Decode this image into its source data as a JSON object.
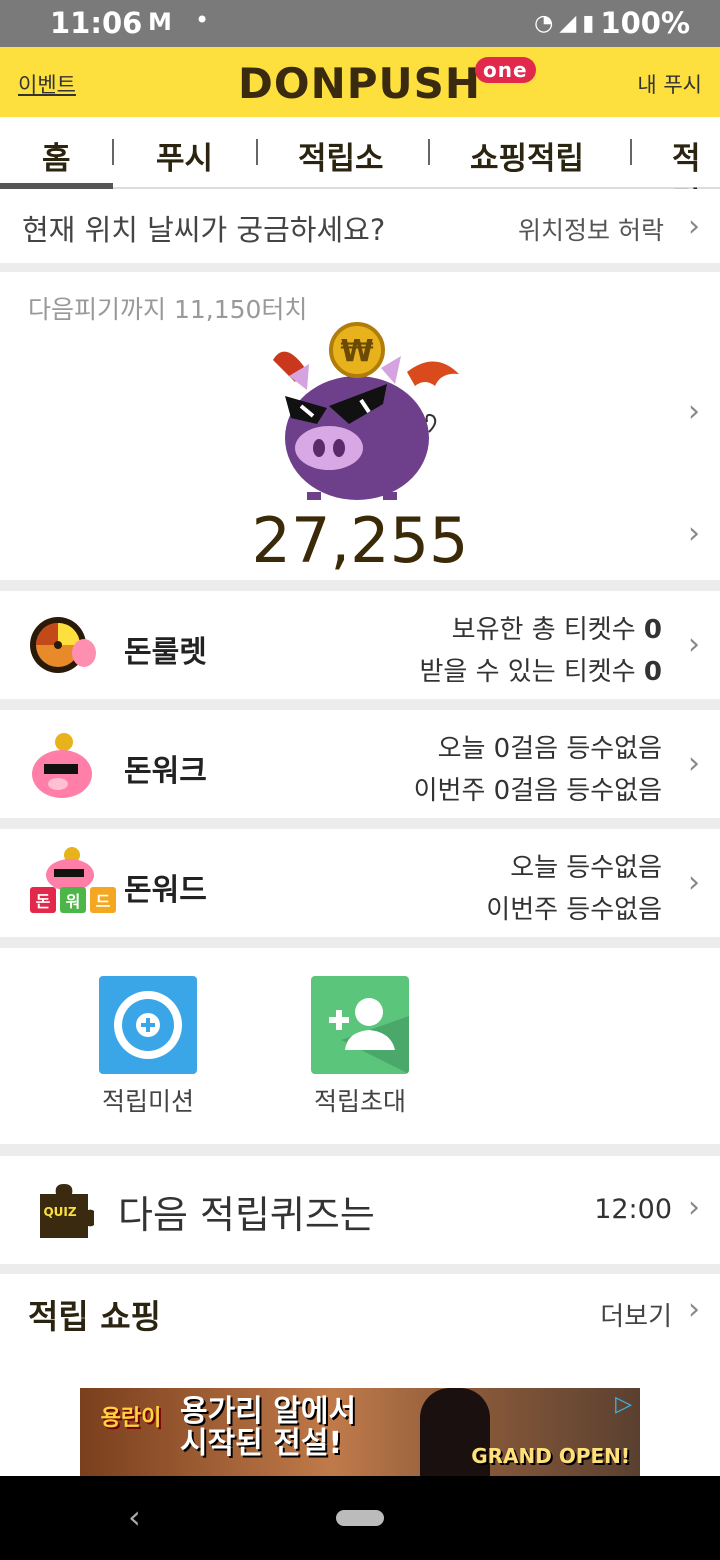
{
  "status": {
    "time": "11:06",
    "mail_icon": "M",
    "battery": "100%"
  },
  "header": {
    "event": "이벤트",
    "logo": "DONPUSH",
    "logo_sup": "one",
    "mypush": "내 푸시"
  },
  "tabs": [
    {
      "label": "홈",
      "active": true
    },
    {
      "label": "푸시"
    },
    {
      "label": "적립소"
    },
    {
      "label": "쇼핑적립"
    },
    {
      "label": "적립"
    }
  ],
  "weather": {
    "question": "현재 위치 날씨가 궁금하세요?",
    "permission": "위치정보 허락"
  },
  "piggy": {
    "next": "다음피기까지 11,150터치",
    "amount": "27,255",
    "coin_symbol": "₩"
  },
  "games": [
    {
      "name": "돈룰렛",
      "line1": "보유한 총 티켓수 ",
      "line1_val": "0",
      "line2": "받을 수 있는 티켓수 ",
      "line2_val": "0"
    },
    {
      "name": "돈워크",
      "line1": "오늘 0걸음 등수없음",
      "line2": "이번주 0걸음 등수없음"
    },
    {
      "name": "돈워드",
      "line1": "오늘 등수없음",
      "line2": "이번주 등수없음",
      "tiles": [
        "돈",
        "워",
        "드"
      ]
    }
  ],
  "shortcuts": [
    {
      "label": "적립미션",
      "icon": "mission-target-icon",
      "color": "#3aa6e8"
    },
    {
      "label": "적립초대",
      "icon": "add-person-icon",
      "color": "#5cc57c"
    }
  ],
  "quiz": {
    "badge": "QUIZ",
    "title": "다음 적립퀴즈는",
    "time": "12:00"
  },
  "shop": {
    "title": "적립 쇼핑",
    "more": "더보기"
  },
  "ad": {
    "game": "용란이",
    "tagline_1": "용가리 알에서",
    "tagline_2": "시작된 전설!",
    "grand": "GRAND OPEN!"
  }
}
